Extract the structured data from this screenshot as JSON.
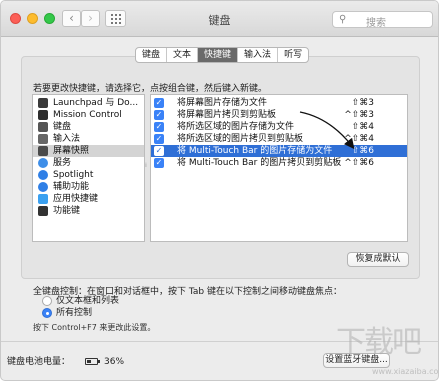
{
  "window": {
    "title": "键盘",
    "search_placeholder": "搜索",
    "search_icon": "magnifier-icon",
    "nav_back": "‹",
    "nav_forward": "›"
  },
  "tabs": [
    {
      "label": "键盘",
      "active": false
    },
    {
      "label": "文本",
      "active": false
    },
    {
      "label": "快捷键",
      "active": true
    },
    {
      "label": "输入法",
      "active": false
    },
    {
      "label": "听写",
      "active": false
    }
  ],
  "instructions": "若要更改快捷键，请选择它，点按组合键，然后键入新键。",
  "categories": [
    {
      "label": "Launchpad 与 Do...",
      "icon": "launchpad-icon",
      "color": "#3a3a3a"
    },
    {
      "label": "Mission Control",
      "icon": "mission-control-icon",
      "color": "#2d2d2d"
    },
    {
      "label": "键盘",
      "icon": "keyboard-icon",
      "color": "#555555"
    },
    {
      "label": "输入法",
      "icon": "input-source-icon",
      "color": "#666666"
    },
    {
      "label": "屏幕快照",
      "icon": "screenshot-icon",
      "color": "#4a4a4a"
    },
    {
      "label": "服务",
      "icon": "services-gear-icon",
      "color": "#3e8ee8"
    },
    {
      "label": "Spotlight",
      "icon": "spotlight-icon",
      "color": "#2f7fe6"
    },
    {
      "label": "辅助功能",
      "icon": "accessibility-icon",
      "color": "#2f7fe6"
    },
    {
      "label": "应用快捷键",
      "icon": "app-shortcuts-icon",
      "color": "#3aa0f0"
    },
    {
      "label": "功能键",
      "icon": "function-keys-icon",
      "color": "#333333"
    }
  ],
  "selected_category_index": 4,
  "shortcuts": [
    {
      "label": "将屏幕图片存储为文件",
      "keys": "⇧⌘3",
      "checked": true
    },
    {
      "label": "将屏幕图片拷贝到剪贴板",
      "keys": "^⇧⌘3",
      "checked": true
    },
    {
      "label": "将所选区域的图片存储为文件",
      "keys": "⇧⌘4",
      "checked": true
    },
    {
      "label": "将所选区域的图片拷贝到剪贴板",
      "keys": "^⇧⌘4",
      "checked": true
    },
    {
      "label": "将 Multi-Touch Bar 的图片存储为文件",
      "keys": "⇧⌘6",
      "checked": true
    },
    {
      "label": "将 Multi-Touch Bar 的图片拷贝到剪贴板",
      "keys": "^⇧⌘6",
      "checked": true
    }
  ],
  "selected_shortcut_index": 4,
  "restore_defaults": "恢复成默认",
  "keyboard_control": "全键盘控制：在窗口和对话框中，按下 Tab 键在以下控制之间移动键盘焦点：",
  "radio_options": [
    {
      "label": "仅文本框和列表",
      "selected": false
    },
    {
      "label": "所有控制",
      "selected": true
    }
  ],
  "hint": "按下 Control+F7 来更改此设置。",
  "battery_label": "键盘电池电量：",
  "battery_percent": "36%",
  "bluetooth_button": "设置蓝牙键盘...",
  "watermark": {
    "logo": "下载吧",
    "url": "www.xiazaiba.com"
  },
  "colors": {
    "accent": "#3a82f7",
    "selection": "#2f6fd6",
    "tab_active": "#6a6a6a"
  }
}
